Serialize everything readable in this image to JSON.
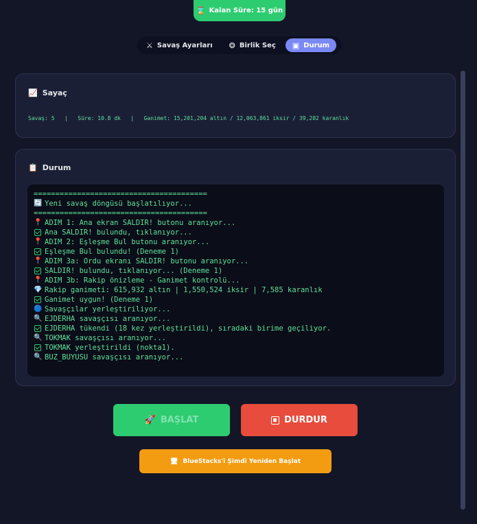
{
  "timer": {
    "label": "Kalan Süre: 15 gün",
    "icon": "hourglass-icon"
  },
  "tabs": [
    {
      "label": "Savaş Ayarları",
      "icon": "swords-icon",
      "active": false
    },
    {
      "label": "Birlik Seç",
      "icon": "unit-icon",
      "active": false
    },
    {
      "label": "Durum",
      "icon": "status-icon",
      "active": true
    }
  ],
  "counter_card": {
    "title": "Sayaç",
    "battles": "Savaş: 5",
    "duration": "Süre: 10.8 dk",
    "loot": "Ganimet: 15,201,204 altın / 12,063,861 iksir / 39,282 karanlık"
  },
  "status_card": {
    "title": "Durum",
    "log": [
      {
        "icon": "",
        "text": "========================================"
      },
      {
        "icon": "refresh",
        "text": "Yeni savaş döngüsü başlatılıyor..."
      },
      {
        "icon": "",
        "text": "========================================"
      },
      {
        "icon": "pin",
        "text": "ADIM 1: Ana ekran SALDIR! butonu aranıyor..."
      },
      {
        "icon": "check",
        "text": "Ana SALDIR! bulundu, tıklanıyor..."
      },
      {
        "icon": "pin",
        "text": "ADIM 2: Eşleşme Bul butonu aranıyor..."
      },
      {
        "icon": "check",
        "text": "Eşleşme Bul bulundu! (Deneme 1)"
      },
      {
        "icon": "pin",
        "text": "ADIM 3a: Ordu ekranı SALDIR! butonu aranıyor..."
      },
      {
        "icon": "check",
        "text": "SALDIR! bulundu, tıklanıyor... (Deneme 1)"
      },
      {
        "icon": "pin",
        "text": "ADIM 3b: Rakip önizleme - Ganimet kontrolü..."
      },
      {
        "icon": "gem",
        "text": "Rakip ganimeti: 615,932 altın | 1,550,524 iksir | 7,585 karanlık"
      },
      {
        "icon": "check",
        "text": "Ganimet uygun! (Deneme 1)"
      },
      {
        "icon": "dot",
        "text": "Savaşçılar yerleştiriliyor..."
      },
      {
        "icon": "search",
        "text": "EJDERHA savaşçısı aranıyor..."
      },
      {
        "icon": "check",
        "text": "EJDERHA tükendi (18 kez yerleştirildi), sıradaki birime geçiliyor."
      },
      {
        "icon": "search",
        "text": "TOKMAK savaşçısı aranıyor..."
      },
      {
        "icon": "check",
        "text": "TOKMAK yerleştirildi (nokta1)."
      },
      {
        "icon": "search",
        "text": "BUZ_BUYUSU savaşçısı aranıyor..."
      }
    ]
  },
  "buttons": {
    "start": "BAŞLAT",
    "stop": "DURDUR",
    "restart": "BlueStacks'i Şimdi Yeniden Başlat"
  },
  "colors": {
    "accent_green": "#2ecc71",
    "accent_red": "#e74c3c",
    "accent_orange": "#f39c12",
    "tab_active": "#7b89f5",
    "log_text": "#5ee19a"
  }
}
